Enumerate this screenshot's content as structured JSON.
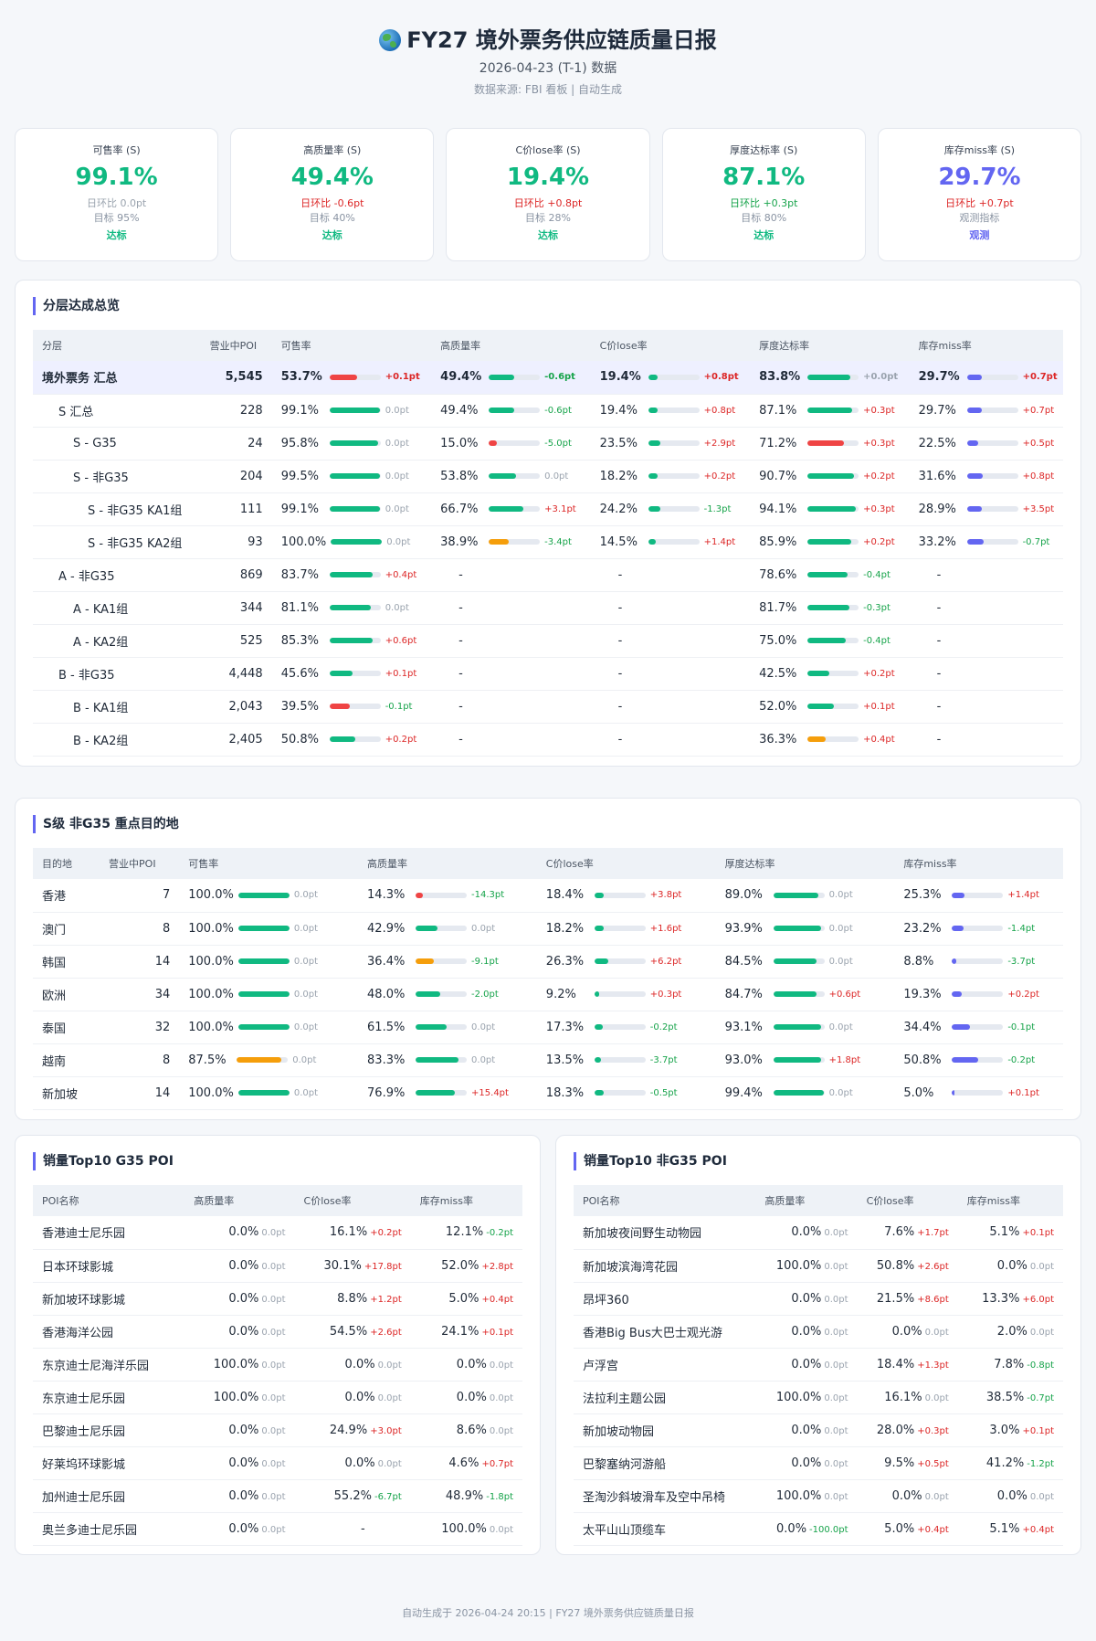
{
  "header": {
    "title": "FY27 境外票务供应链质量日报",
    "subtitle": "2026-04-23 (T-1) 数据",
    "source": "数据来源: FBI 看板 | 自动生成"
  },
  "colors": {
    "green": "#10b981",
    "red": "#ef4444",
    "orange": "#f59e0b",
    "purple": "#6366f1"
  },
  "kpis": [
    {
      "label": "可售率 (S)",
      "value": "99.1%",
      "delta": "日环比 0.0pt",
      "delta_kind": "zero",
      "target": "目标 95%",
      "status": "达标",
      "color": "green"
    },
    {
      "label": "高质量率 (S)",
      "value": "49.4%",
      "delta": "日环比 -0.6pt",
      "delta_kind": "pos",
      "target": "目标 40%",
      "status": "达标",
      "color": "green"
    },
    {
      "label": "C价lose率 (S)",
      "value": "19.4%",
      "delta": "日环比 +0.8pt",
      "delta_kind": "pos",
      "target": "目标 28%",
      "status": "达标",
      "color": "green"
    },
    {
      "label": "厚度达标率 (S)",
      "value": "87.1%",
      "delta": "日环比 +0.3pt",
      "delta_kind": "neg",
      "target": "目标 80%",
      "status": "达标",
      "color": "green"
    },
    {
      "label": "库存miss率 (S)",
      "value": "29.7%",
      "delta": "日环比 +0.7pt",
      "delta_kind": "pos",
      "target": "观测指标",
      "status": "观测",
      "color": "purple"
    }
  ],
  "tier": {
    "title": "分层达成总览",
    "headers": [
      "分层",
      "营业中POI",
      "可售率",
      "高质量率",
      "C价lose率",
      "厚度达标率",
      "库存miss率"
    ],
    "rows": [
      {
        "name": "境外票务 汇总",
        "level": 0,
        "total": true,
        "poi": "5,545",
        "cells": [
          [
            "53.7%",
            "+0.1pt",
            53.7,
            "red"
          ],
          [
            "49.4%",
            "-0.6pt",
            49.4,
            "green"
          ],
          [
            "19.4%",
            "+0.8pt",
            19.4,
            "green"
          ],
          [
            "83.8%",
            "+0.0pt",
            83.8,
            "green"
          ],
          [
            "29.7%",
            "+0.7pt",
            29.7,
            "purple"
          ]
        ]
      },
      {
        "name": "S 汇总",
        "level": 1,
        "poi": "228",
        "cells": [
          [
            "99.1%",
            "0.0pt",
            99.1,
            "green"
          ],
          [
            "49.4%",
            "-0.6pt",
            49.4,
            "green"
          ],
          [
            "19.4%",
            "+0.8pt",
            19.4,
            "green"
          ],
          [
            "87.1%",
            "+0.3pt",
            87.1,
            "green"
          ],
          [
            "29.7%",
            "+0.7pt",
            29.7,
            "purple"
          ]
        ]
      },
      {
        "name": "S - G35",
        "level": 2,
        "poi": "24",
        "cells": [
          [
            "95.8%",
            "0.0pt",
            95.8,
            "green"
          ],
          [
            "15.0%",
            "-5.0pt",
            15.0,
            "red"
          ],
          [
            "23.5%",
            "+2.9pt",
            23.5,
            "green"
          ],
          [
            "71.2%",
            "+0.3pt",
            71.2,
            "red"
          ],
          [
            "22.5%",
            "+0.5pt",
            22.5,
            "purple"
          ]
        ]
      },
      {
        "name": "S - 非G35",
        "level": 2,
        "poi": "204",
        "cells": [
          [
            "99.5%",
            "0.0pt",
            99.5,
            "green"
          ],
          [
            "53.8%",
            "0.0pt",
            53.8,
            "green"
          ],
          [
            "18.2%",
            "+0.2pt",
            18.2,
            "green"
          ],
          [
            "90.7%",
            "+0.2pt",
            90.7,
            "green"
          ],
          [
            "31.6%",
            "+0.8pt",
            31.6,
            "purple"
          ]
        ]
      },
      {
        "name": "S - 非G35 KA1组",
        "level": 3,
        "poi": "111",
        "cells": [
          [
            "99.1%",
            "0.0pt",
            99.1,
            "green"
          ],
          [
            "66.7%",
            "+3.1pt",
            66.7,
            "green"
          ],
          [
            "24.2%",
            "-1.3pt",
            24.2,
            "green"
          ],
          [
            "94.1%",
            "+0.3pt",
            94.1,
            "green"
          ],
          [
            "28.9%",
            "+3.5pt",
            28.9,
            "purple"
          ]
        ]
      },
      {
        "name": "S - 非G35 KA2组",
        "level": 3,
        "poi": "93",
        "cells": [
          [
            "100.0%",
            "0.0pt",
            100.0,
            "green"
          ],
          [
            "38.9%",
            "-3.4pt",
            38.9,
            "orange"
          ],
          [
            "14.5%",
            "+1.4pt",
            14.5,
            "green"
          ],
          [
            "85.9%",
            "+0.2pt",
            85.9,
            "green"
          ],
          [
            "33.2%",
            "-0.7pt",
            33.2,
            "purple"
          ]
        ]
      },
      {
        "name": "A - 非G35",
        "level": 1,
        "poi": "869",
        "cells": [
          [
            "83.7%",
            "+0.4pt",
            83.7,
            "green"
          ],
          null,
          null,
          [
            "78.6%",
            "-0.4pt",
            78.6,
            "green"
          ],
          null
        ]
      },
      {
        "name": "A - KA1组",
        "level": 2,
        "poi": "344",
        "cells": [
          [
            "81.1%",
            "0.0pt",
            81.1,
            "green"
          ],
          null,
          null,
          [
            "81.7%",
            "-0.3pt",
            81.7,
            "green"
          ],
          null
        ]
      },
      {
        "name": "A - KA2组",
        "level": 2,
        "poi": "525",
        "cells": [
          [
            "85.3%",
            "+0.6pt",
            85.3,
            "green"
          ],
          null,
          null,
          [
            "75.0%",
            "-0.4pt",
            75.0,
            "green"
          ],
          null
        ]
      },
      {
        "name": "B - 非G35",
        "level": 1,
        "poi": "4,448",
        "cells": [
          [
            "45.6%",
            "+0.1pt",
            45.6,
            "green"
          ],
          null,
          null,
          [
            "42.5%",
            "+0.2pt",
            42.5,
            "green"
          ],
          null
        ]
      },
      {
        "name": "B - KA1组",
        "level": 2,
        "poi": "2,043",
        "cells": [
          [
            "39.5%",
            "-0.1pt",
            39.5,
            "red"
          ],
          null,
          null,
          [
            "52.0%",
            "+0.1pt",
            52.0,
            "green"
          ],
          null
        ]
      },
      {
        "name": "B - KA2组",
        "level": 2,
        "poi": "2,405",
        "cells": [
          [
            "50.8%",
            "+0.2pt",
            50.8,
            "green"
          ],
          null,
          null,
          [
            "36.3%",
            "+0.4pt",
            36.3,
            "orange"
          ],
          null
        ]
      }
    ]
  },
  "dest": {
    "title": "S级 非G35 重点目的地",
    "headers": [
      "目的地",
      "营业中POI",
      "可售率",
      "高质量率",
      "C价lose率",
      "厚度达标率",
      "库存miss率"
    ],
    "rows": [
      {
        "name": "香港",
        "poi": "7",
        "cells": [
          [
            "100.0%",
            "0.0pt",
            100,
            "green"
          ],
          [
            "14.3%",
            "-14.3pt",
            14.3,
            "red"
          ],
          [
            "18.4%",
            "+3.8pt",
            18.4,
            "green"
          ],
          [
            "89.0%",
            "0.0pt",
            89.0,
            "green"
          ],
          [
            "25.3%",
            "+1.4pt",
            25.3,
            "purple"
          ]
        ]
      },
      {
        "name": "澳门",
        "poi": "8",
        "cells": [
          [
            "100.0%",
            "0.0pt",
            100,
            "green"
          ],
          [
            "42.9%",
            "0.0pt",
            42.9,
            "green"
          ],
          [
            "18.2%",
            "+1.6pt",
            18.2,
            "green"
          ],
          [
            "93.9%",
            "0.0pt",
            93.9,
            "green"
          ],
          [
            "23.2%",
            "-1.4pt",
            23.2,
            "purple"
          ]
        ]
      },
      {
        "name": "韩国",
        "poi": "14",
        "cells": [
          [
            "100.0%",
            "0.0pt",
            100,
            "green"
          ],
          [
            "36.4%",
            "-9.1pt",
            36.4,
            "orange"
          ],
          [
            "26.3%",
            "+6.2pt",
            26.3,
            "green"
          ],
          [
            "84.5%",
            "0.0pt",
            84.5,
            "green"
          ],
          [
            "8.8%",
            "-3.7pt",
            8.8,
            "purple"
          ]
        ]
      },
      {
        "name": "欧洲",
        "poi": "34",
        "cells": [
          [
            "100.0%",
            "0.0pt",
            100,
            "green"
          ],
          [
            "48.0%",
            "-2.0pt",
            48.0,
            "green"
          ],
          [
            "9.2%",
            "+0.3pt",
            9.2,
            "green"
          ],
          [
            "84.7%",
            "+0.6pt",
            84.7,
            "green"
          ],
          [
            "19.3%",
            "+0.2pt",
            19.3,
            "purple"
          ]
        ]
      },
      {
        "name": "泰国",
        "poi": "32",
        "cells": [
          [
            "100.0%",
            "0.0pt",
            100,
            "green"
          ],
          [
            "61.5%",
            "0.0pt",
            61.5,
            "green"
          ],
          [
            "17.3%",
            "-0.2pt",
            17.3,
            "green"
          ],
          [
            "93.1%",
            "0.0pt",
            93.1,
            "green"
          ],
          [
            "34.4%",
            "-0.1pt",
            34.4,
            "purple"
          ]
        ]
      },
      {
        "name": "越南",
        "poi": "8",
        "cells": [
          [
            "87.5%",
            "0.0pt",
            87.5,
            "orange"
          ],
          [
            "83.3%",
            "0.0pt",
            83.3,
            "green"
          ],
          [
            "13.5%",
            "-3.7pt",
            13.5,
            "green"
          ],
          [
            "93.0%",
            "+1.8pt",
            93.0,
            "green"
          ],
          [
            "50.8%",
            "-0.2pt",
            50.8,
            "purple"
          ]
        ]
      },
      {
        "name": "新加坡",
        "poi": "14",
        "cells": [
          [
            "100.0%",
            "0.0pt",
            100,
            "green"
          ],
          [
            "76.9%",
            "+15.4pt",
            76.9,
            "green"
          ],
          [
            "18.3%",
            "-0.5pt",
            18.3,
            "green"
          ],
          [
            "99.4%",
            "0.0pt",
            99.4,
            "green"
          ],
          [
            "5.0%",
            "+0.1pt",
            5.0,
            "purple"
          ]
        ]
      }
    ]
  },
  "top_g35": {
    "title": "销量Top10 G35 POI",
    "headers": [
      "POI名称",
      "高质量率",
      "C价lose率",
      "库存miss率"
    ],
    "rows": [
      {
        "name": "香港迪士尼乐园",
        "cells": [
          [
            "0.0%",
            "0.0pt"
          ],
          [
            "16.1%",
            "+0.2pt"
          ],
          [
            "12.1%",
            "-0.2pt"
          ]
        ]
      },
      {
        "name": "日本环球影城",
        "cells": [
          [
            "0.0%",
            "0.0pt"
          ],
          [
            "30.1%",
            "+17.8pt"
          ],
          [
            "52.0%",
            "+2.8pt"
          ]
        ]
      },
      {
        "name": "新加坡环球影城",
        "cells": [
          [
            "0.0%",
            "0.0pt"
          ],
          [
            "8.8%",
            "+1.2pt"
          ],
          [
            "5.0%",
            "+0.4pt"
          ]
        ]
      },
      {
        "name": "香港海洋公园",
        "cells": [
          [
            "0.0%",
            "0.0pt"
          ],
          [
            "54.5%",
            "+2.6pt"
          ],
          [
            "24.1%",
            "+0.1pt"
          ]
        ]
      },
      {
        "name": "东京迪士尼海洋乐园",
        "cells": [
          [
            "100.0%",
            "0.0pt"
          ],
          [
            "0.0%",
            "0.0pt"
          ],
          [
            "0.0%",
            "0.0pt"
          ]
        ]
      },
      {
        "name": "东京迪士尼乐园",
        "cells": [
          [
            "100.0%",
            "0.0pt"
          ],
          [
            "0.0%",
            "0.0pt"
          ],
          [
            "0.0%",
            "0.0pt"
          ]
        ]
      },
      {
        "name": "巴黎迪士尼乐园",
        "cells": [
          [
            "0.0%",
            "0.0pt"
          ],
          [
            "24.9%",
            "+3.0pt"
          ],
          [
            "8.6%",
            "0.0pt"
          ]
        ]
      },
      {
        "name": "好莱坞环球影城",
        "cells": [
          [
            "0.0%",
            "0.0pt"
          ],
          [
            "0.0%",
            "0.0pt"
          ],
          [
            "4.6%",
            "+0.7pt"
          ]
        ]
      },
      {
        "name": "加州迪士尼乐园",
        "cells": [
          [
            "0.0%",
            "0.0pt"
          ],
          [
            "55.2%",
            "-6.7pt"
          ],
          [
            "48.9%",
            "-1.8pt"
          ]
        ]
      },
      {
        "name": "奥兰多迪士尼乐园",
        "cells": [
          [
            "0.0%",
            "0.0pt"
          ],
          null,
          [
            "100.0%",
            "0.0pt"
          ]
        ]
      }
    ]
  },
  "top_non_g35": {
    "title": "销量Top10 非G35 POI",
    "headers": [
      "POI名称",
      "高质量率",
      "C价lose率",
      "库存miss率"
    ],
    "rows": [
      {
        "name": "新加坡夜间野生动物园",
        "cells": [
          [
            "0.0%",
            "0.0pt"
          ],
          [
            "7.6%",
            "+1.7pt"
          ],
          [
            "5.1%",
            "+0.1pt"
          ]
        ]
      },
      {
        "name": "新加坡滨海湾花园",
        "cells": [
          [
            "100.0%",
            "0.0pt"
          ],
          [
            "50.8%",
            "+2.6pt"
          ],
          [
            "0.0%",
            "0.0pt"
          ]
        ]
      },
      {
        "name": "昂坪360",
        "cells": [
          [
            "0.0%",
            "0.0pt"
          ],
          [
            "21.5%",
            "+8.6pt"
          ],
          [
            "13.3%",
            "+6.0pt"
          ]
        ]
      },
      {
        "name": "香港Big Bus大巴士观光游",
        "cells": [
          [
            "0.0%",
            "0.0pt"
          ],
          [
            "0.0%",
            "0.0pt"
          ],
          [
            "2.0%",
            "0.0pt"
          ]
        ]
      },
      {
        "name": "卢浮宫",
        "cells": [
          [
            "0.0%",
            "0.0pt"
          ],
          [
            "18.4%",
            "+1.3pt"
          ],
          [
            "7.8%",
            "-0.8pt"
          ]
        ]
      },
      {
        "name": "法拉利主题公园",
        "cells": [
          [
            "100.0%",
            "0.0pt"
          ],
          [
            "16.1%",
            "0.0pt"
          ],
          [
            "38.5%",
            "-0.7pt"
          ]
        ]
      },
      {
        "name": "新加坡动物园",
        "cells": [
          [
            "0.0%",
            "0.0pt"
          ],
          [
            "28.0%",
            "+0.3pt"
          ],
          [
            "3.0%",
            "+0.1pt"
          ]
        ]
      },
      {
        "name": "巴黎塞纳河游船",
        "cells": [
          [
            "0.0%",
            "0.0pt"
          ],
          [
            "9.5%",
            "+0.5pt"
          ],
          [
            "41.2%",
            "-1.2pt"
          ]
        ]
      },
      {
        "name": "圣淘沙斜坡滑车及空中吊椅",
        "cells": [
          [
            "100.0%",
            "0.0pt"
          ],
          [
            "0.0%",
            "0.0pt"
          ],
          [
            "0.0%",
            "0.0pt"
          ]
        ]
      },
      {
        "name": "太平山山顶缆车",
        "cells": [
          [
            "0.0%",
            "-100.0pt"
          ],
          [
            "5.0%",
            "+0.4pt"
          ],
          [
            "5.1%",
            "+0.4pt"
          ]
        ]
      }
    ]
  },
  "footer": "自动生成于 2026-04-24 20:15 | FY27 境外票务供应链质量日报"
}
